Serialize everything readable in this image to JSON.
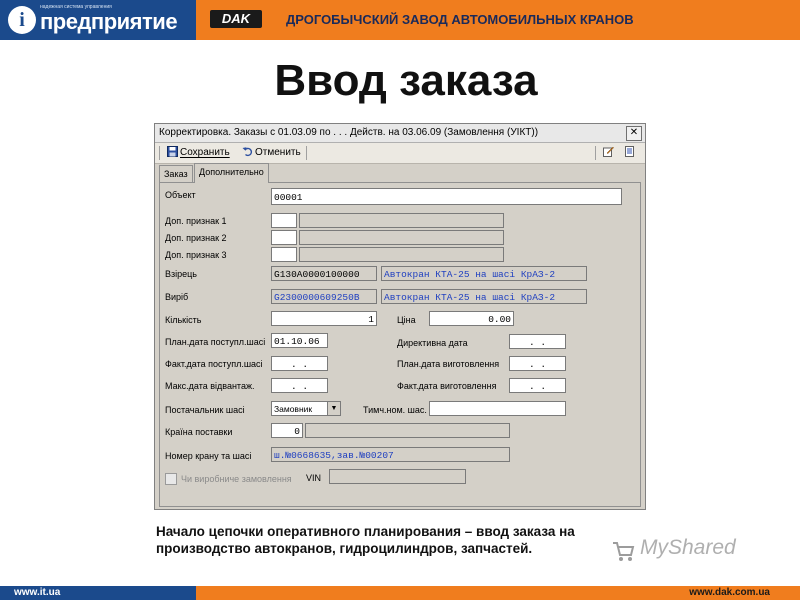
{
  "header": {
    "logo_small": "надежная система управления",
    "logo_text": "предприятие",
    "dak_logo": "DAK",
    "title": "ДРОГОБЫЧСКИЙ ЗАВОД АВТОМОБИЛЬНЫХ КРАНОВ"
  },
  "slide_title": "Ввод заказа",
  "window": {
    "title": "Корректировка. Заказы с 01.03.09 по  . . . Действ. на 03.06.09 (Замовлення (УІКТ))",
    "close_label": "✕",
    "toolbar": {
      "save_label": "Сохранить",
      "cancel_label": "Отменить"
    },
    "tabs": [
      "Заказ",
      "Дополнительно"
    ],
    "fields": {
      "object_label": "Объект",
      "object_value": "00001",
      "attr1_label": "Доп. признак 1",
      "attr2_label": "Доп. признак 2",
      "attr3_label": "Доп. признак 3",
      "sample_label": "Взірець",
      "sample_code": "G130A0000100000",
      "sample_name": "Автокран КТА-25 на шасі КрАЗ-2",
      "product_label": "Виріб",
      "product_code": "G2300000609250B",
      "product_name": "Автокран КТА-25 на шасі КрАЗ-2",
      "qty_label": "Кількість",
      "qty_value": "1",
      "price_label": "Ціна",
      "price_value": "0.00",
      "plan_receipt_label": "План.дата поступл.шасі",
      "plan_receipt_value": "01.10.06",
      "directive_label": "Директивна дата",
      "directive_value": ". .",
      "fact_receipt_label": "Факт.дата поступл.шасі",
      "fact_receipt_value": ". .",
      "plan_make_label": "План.дата виготовлення",
      "plan_make_value": ". .",
      "max_ship_label": "Макс.дата відвантаж.",
      "max_ship_value": ". .",
      "fact_make_label": "Факт.дата виготовлення",
      "fact_make_value": ". .",
      "supplier_label": "Постачальник шасі",
      "supplier_value": "Замовник",
      "temp_no_label": "Тимч.ном. шас.",
      "country_label": "Країна поставки",
      "country_value": "0",
      "crane_no_label": "Номер крану та шасі",
      "crane_no_value": "ш.№0668635,зав.№00207",
      "producer_order_label": "Чи виробниче замовлення",
      "vin_label": "VIN"
    }
  },
  "caption": {
    "line1": "Начало цепочки оперативного планирования – ввод заказа на",
    "line2": "производство автокранов, гидроцилиндров, запчастей."
  },
  "watermark": "MyShared",
  "footer": {
    "left": "www.it.ua",
    "right": "www.dak.com.ua"
  },
  "colors": {
    "orange": "#f07d1e",
    "blue": "#1b4a8c",
    "window_bg": "#d4d0c8",
    "field_text_blue": "#2040c0"
  }
}
